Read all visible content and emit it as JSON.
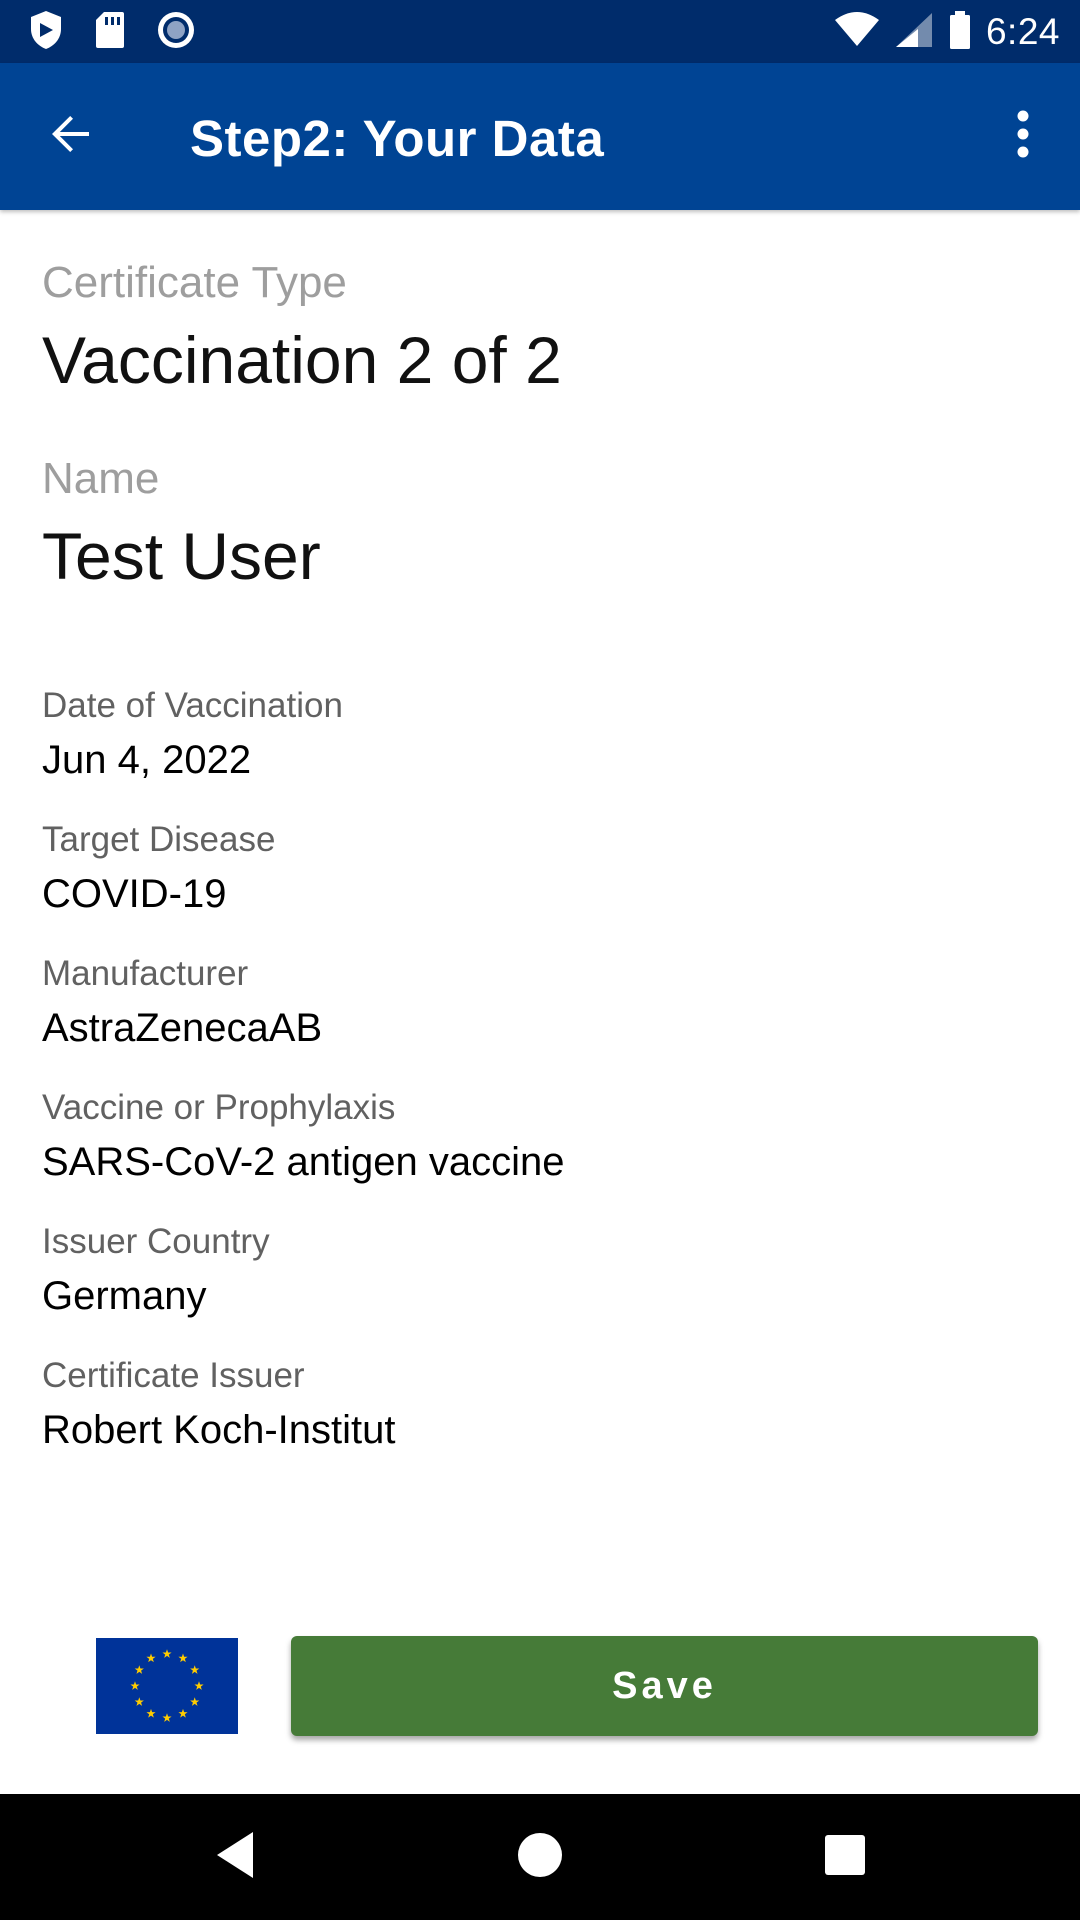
{
  "status_bar": {
    "time": "6:24",
    "left_icons": [
      "shield-icon",
      "sd-card-icon",
      "record-icon"
    ],
    "right_icons": [
      "wifi-icon",
      "cell-signal-icon",
      "battery-icon"
    ]
  },
  "app_bar": {
    "title": "Step2: Your Data",
    "back_icon": "arrow-back-icon",
    "menu_icon": "more-vert-icon"
  },
  "certificate": {
    "type_label": "Certificate Type",
    "type_value": "Vaccination 2 of 2",
    "name_label": "Name",
    "name_value": "Test User"
  },
  "details": [
    {
      "label": "Date of Vaccination",
      "value": "Jun 4, 2022"
    },
    {
      "label": "Target Disease",
      "value": "COVID-19"
    },
    {
      "label": "Manufacturer",
      "value": "AstraZenecaAB"
    },
    {
      "label": "Vaccine or Prophylaxis",
      "value": "SARS-CoV-2 antigen vaccine"
    },
    {
      "label": "Issuer Country",
      "value": "Germany"
    },
    {
      "label": "Certificate Issuer",
      "value": "Robert Koch-Institut"
    }
  ],
  "footer": {
    "save_label": "Save",
    "flag_icon": "eu-flag-icon"
  },
  "colors": {
    "status_bar": "#002c6b",
    "app_bar": "#004494",
    "save_button": "#467b38",
    "eu_blue": "#003399",
    "eu_gold": "#ffcc00"
  },
  "nav_bar": {
    "icons": [
      "back-triangle-icon",
      "home-circle-icon",
      "recents-square-icon"
    ]
  }
}
